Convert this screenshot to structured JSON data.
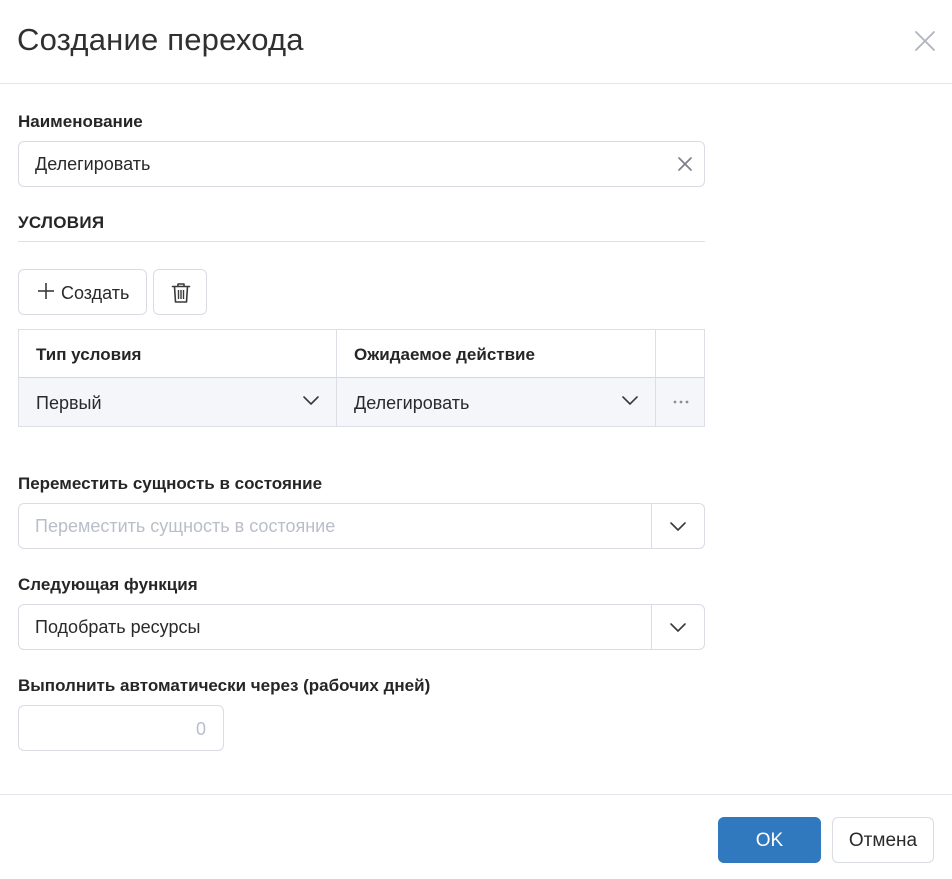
{
  "dialog": {
    "title": "Создание перехода",
    "close_icon": "close-icon"
  },
  "name_field": {
    "label": "Наименование",
    "value": "Делегировать",
    "clear_icon": "clear-icon"
  },
  "conditions": {
    "section_title": "УСЛОВИЯ",
    "create_label": "Создать",
    "create_icon": "plus-icon",
    "delete_icon": "trash-icon",
    "table": {
      "headers": [
        "Тип условия",
        "Ожидаемое действие"
      ],
      "rows": [
        {
          "condition_type": "Первый",
          "expected_action": "Делегировать"
        }
      ],
      "row_menu_icon": "ellipsis-icon"
    }
  },
  "move_state": {
    "label": "Переместить сущность в состояние",
    "placeholder": "Переместить сущность в состояние",
    "value": ""
  },
  "next_function": {
    "label": "Следующая функция",
    "value": "Подобрать ресурсы"
  },
  "auto_execute": {
    "label": "Выполнить автоматически через (рабочих дней)",
    "value": "0"
  },
  "footer": {
    "ok_label": "OK",
    "cancel_label": "Отмена",
    "primary_color": "#3179be"
  }
}
